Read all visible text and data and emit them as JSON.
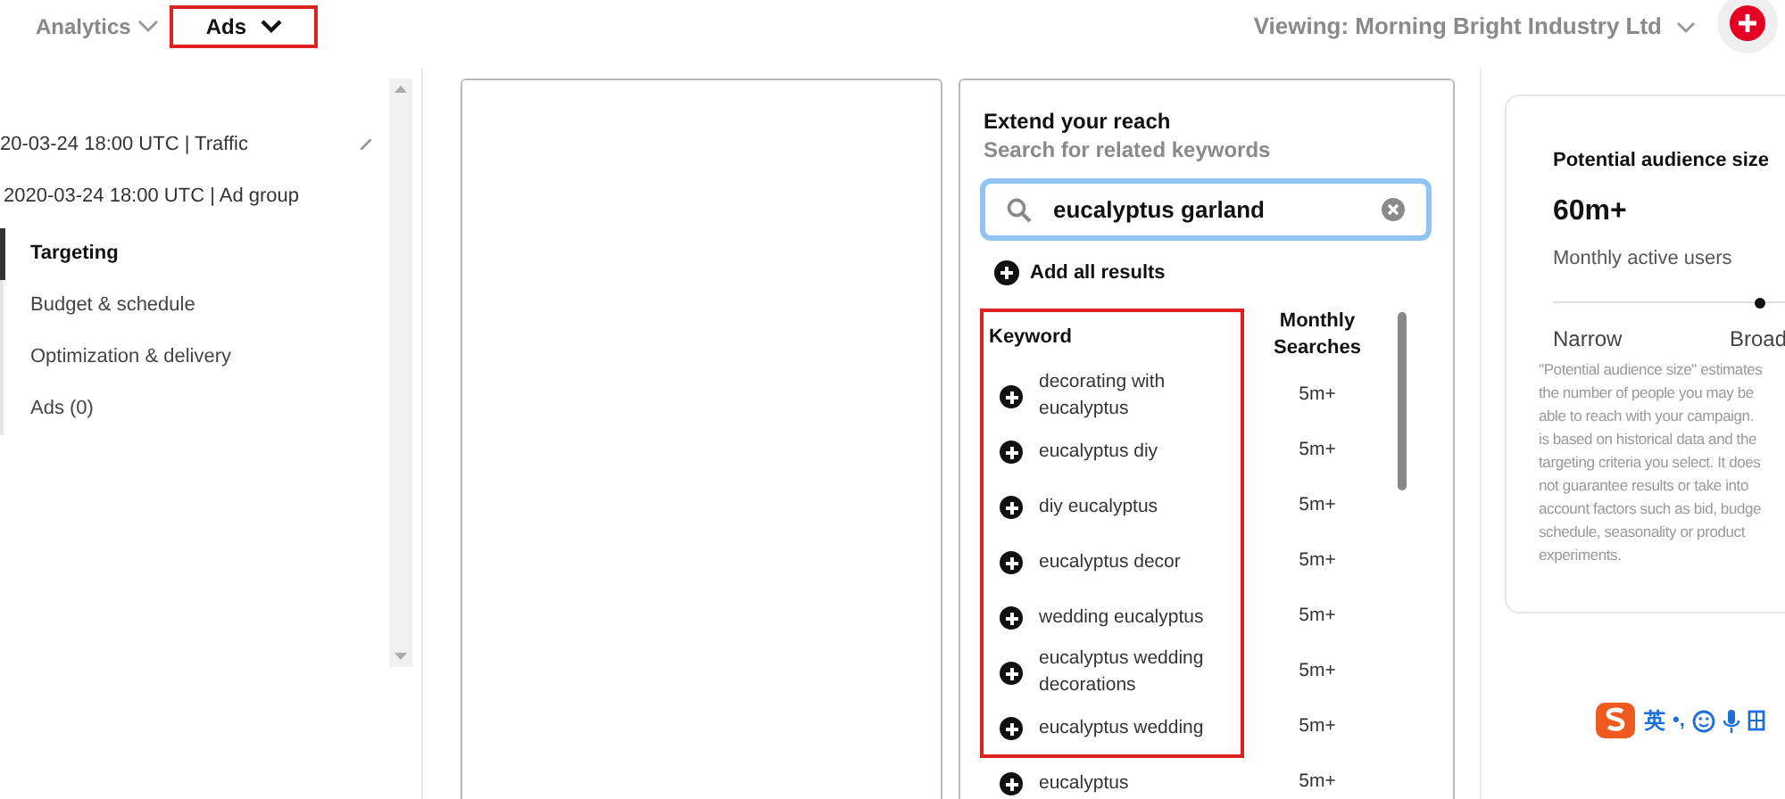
{
  "top_tabs": [
    {
      "label": "Analytics",
      "selected": false
    },
    {
      "label": "Ads",
      "selected": true
    }
  ],
  "account": {
    "label": "Viewing: Morning Bright Industry Ltd"
  },
  "sidebar": {
    "campaign": "20-03-24 18:00 UTC | Traffic",
    "ad_group": "2020-03-24 18:00 UTC | Ad group",
    "items": [
      {
        "label": "Targeting",
        "selected": true
      },
      {
        "label": "Budget & schedule",
        "selected": false
      },
      {
        "label": "Optimization & delivery",
        "selected": false
      },
      {
        "label": "Ads (0)",
        "selected": false
      }
    ]
  },
  "keywords_panel": {
    "title": "Extend your reach",
    "subtitle": "Search for related keywords",
    "search": {
      "value": "eucalyptus garland"
    },
    "add_all": "Add all results",
    "columns": [
      "Keyword",
      "Monthly Searches"
    ],
    "rows": [
      {
        "keyword": "decorating with eucalyptus",
        "searches": "5m+"
      },
      {
        "keyword": "eucalyptus diy",
        "searches": "5m+"
      },
      {
        "keyword": "diy eucalyptus",
        "searches": "5m+"
      },
      {
        "keyword": "eucalyptus decor",
        "searches": "5m+"
      },
      {
        "keyword": "wedding eucalyptus",
        "searches": "5m+"
      },
      {
        "keyword": "eucalyptus wedding decorations",
        "searches": "5m+"
      },
      {
        "keyword": "eucalyptus wedding",
        "searches": "5m+"
      },
      {
        "keyword": "eucalyptus",
        "searches": "5m+"
      }
    ]
  },
  "audience": {
    "title": "Potential audience size",
    "value": "60m+",
    "caption": "Monthly active users",
    "slider": {
      "level": 0.9,
      "min_label": "Narrow",
      "max_label": "Broad"
    },
    "note_lines": [
      "\"Potential audience size\" estimates",
      "the number of people you may be",
      "able to reach with your campaign.",
      "is based on historical data and the",
      "targeting criteria you select. It does",
      "not guarantee results or take into",
      "account factors such as bid, budge",
      "schedule, seasonality or product",
      "experiments."
    ]
  },
  "ime_toolbar": {
    "language": "英",
    "punctuation": "•,"
  }
}
